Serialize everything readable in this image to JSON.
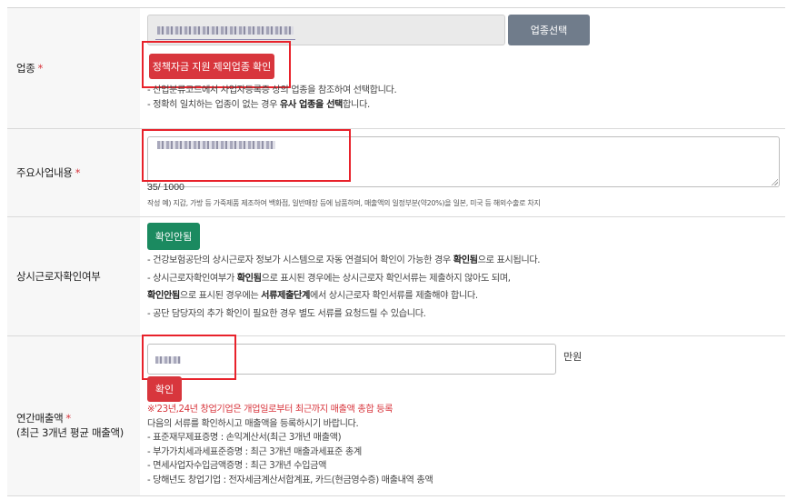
{
  "industry": {
    "label": "업종",
    "required_mark": "*",
    "select_button": "업종선택",
    "policy_button": "정책자금 지원 제외업종 확인",
    "guides": [
      "- 산업분류코드에서 사업자등록증 상의 업종을 참조하여 선택합니다.",
      [
        "- 정확히 일치하는 업종이 없는 경우 ",
        "유사 업종을 선택",
        "합니다."
      ]
    ]
  },
  "business": {
    "label": "주요사업내용",
    "required_mark": "*",
    "counter": "35/ 1000",
    "example": "작성 예) 지갑, 가방 등 가죽제품 제조하여 백화점, 일반매장 등에 납품하며, 매출액의 일정부분(약20%)을 일본, 미국 등 해외수출로 차지"
  },
  "worker": {
    "label": "상시근로자확인여부",
    "status_button": "확인안됨",
    "guides": [
      [
        "- 건강보험공단의 상시근로자 정보가 시스템으로 자동 연결되어 확인이 가능한 경우 ",
        "확인됨",
        "으로 표시됩니다."
      ],
      [
        "- 상시근로자확인여부가 ",
        "확인됨",
        "으로 표시된 경우에는 상시근로자 확인서류는 제출하지 않아도 되며,"
      ],
      [
        "",
        "확인안됨",
        "으로 표시된 경우에는 ",
        "서류제출단계",
        "에서 상시근로자 확인서류를 제출해야 합니다."
      ],
      [
        "- 공단 담당자의 추가 확인이 필요한 경우 별도 서류를 요청드릴 수 있습니다."
      ]
    ]
  },
  "sales": {
    "label_line1": "연간매출액",
    "required_mark": "*",
    "label_line2": "(최근 3개년 평균 매출액)",
    "unit": "만원",
    "confirm_button": "확인",
    "note_red": "※'23년,24년 창업기업은 개업일로부터 최근까지 매출액 총합 등록",
    "note": "다음의 서류를 확인하시고 매출액을 등록하시기 바랍니다.",
    "docs": [
      "- 표준재무제표증명 : 손익계산서(최근 3개년 매출액)",
      "- 부가가치세과세표준증명 : 최근 3개년 매출과세표준 총계",
      "- 면세사업자수입금액증명 : 최근 3개년 수입금액",
      "- 당해년도 창업기업 : 전자세금계산서합계표, 카드(현금영수증) 매출내역 총액"
    ]
  },
  "colors": {
    "accent_red": "#d8363d",
    "green": "#1b8a60",
    "slate": "#707c8b",
    "highlight": "#e8222b"
  }
}
